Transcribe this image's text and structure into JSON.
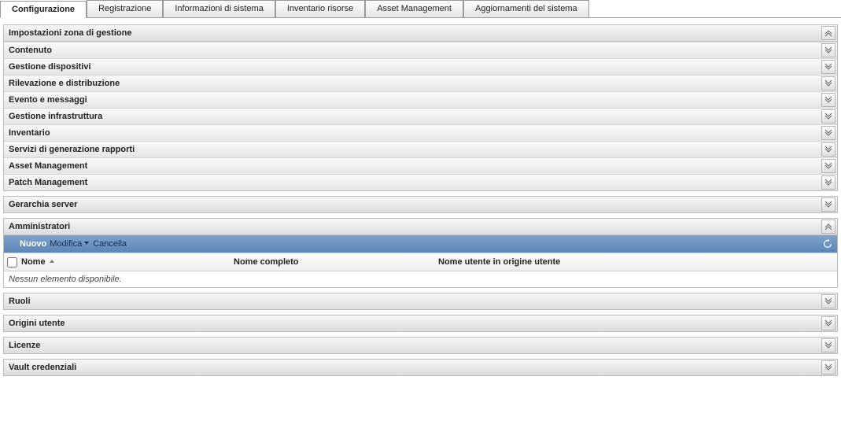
{
  "tabs": {
    "items": [
      {
        "label": "Configurazione",
        "active": true
      },
      {
        "label": "Registrazione"
      },
      {
        "label": "Informazioni di sistema"
      },
      {
        "label": "Inventario risorse"
      },
      {
        "label": "Asset Management"
      },
      {
        "label": "Aggiornamenti del sistema"
      }
    ]
  },
  "zone_settings": {
    "title": "Impostazioni zona di gestione",
    "expanded": true,
    "items": [
      {
        "label": "Contenuto"
      },
      {
        "label": "Gestione dispositivi"
      },
      {
        "label": "Rilevazione e distribuzione"
      },
      {
        "label": "Evento e messaggi"
      },
      {
        "label": "Gestione infrastruttura"
      },
      {
        "label": "Inventario"
      },
      {
        "label": "Servizi di generazione rapporti"
      },
      {
        "label": "Asset Management"
      },
      {
        "label": "Patch Management"
      }
    ]
  },
  "server_hierarchy": {
    "title": "Gerarchia server",
    "expanded": false
  },
  "administrators": {
    "title": "Amministratori",
    "expanded": true,
    "toolbar": {
      "new": "Nuovo",
      "edit": "Modifica",
      "delete": "Cancella"
    },
    "columns": {
      "name": "Nome",
      "full_name": "Nome completo",
      "user_source": "Nome utente in origine utente"
    },
    "empty_message": "Nessun elemento disponibile."
  },
  "roles": {
    "title": "Ruoli",
    "expanded": false
  },
  "user_sources": {
    "title": "Origini utente",
    "expanded": false
  },
  "licenses": {
    "title": "Licenze",
    "expanded": false
  },
  "credential_vault": {
    "title": "Vault credenziali",
    "expanded": false
  }
}
